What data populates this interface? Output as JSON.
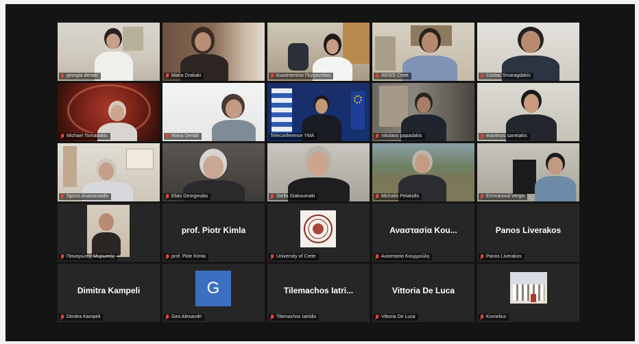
{
  "participants": [
    {
      "name": "georgia deriaki",
      "muted": true
    },
    {
      "name": "Maria Drakaki",
      "muted": true
    },
    {
      "name": "Κωνσταντίνα Περγαντάκη",
      "muted": true
    },
    {
      "name": "ARSIS Crete",
      "muted": true
    },
    {
      "name": "Costas Smaragdakis",
      "muted": true
    },
    {
      "name": "Michael Tornadakis",
      "muted": true
    },
    {
      "name": "Maria Dertali",
      "muted": true
    },
    {
      "name": "Teleconference ΥΜΑ",
      "muted": true,
      "active_speaker": true
    },
    {
      "name": "nikolaos papadakis",
      "muted": true
    },
    {
      "name": "eravimos sanetakis",
      "muted": true
    },
    {
      "name": "Spiros Anastasiadis",
      "muted": true
    },
    {
      "name": "Elias Georgeulas",
      "muted": true
    },
    {
      "name": "Stella Giakoumaki",
      "muted": true
    },
    {
      "name": "Michalis Pelakidis",
      "muted": true
    },
    {
      "name": "Emmanouil Vergis",
      "muted": true
    },
    {
      "name": "Παναγιώτης Μυρωπής",
      "muted": true
    },
    {
      "name": "prof. Piotr Kimla",
      "muted": true,
      "display_name": "prof. Piotr Kimla"
    },
    {
      "name": "University of Crete",
      "muted": true
    },
    {
      "name": "Αναστασία Κουρμούλη",
      "muted": true,
      "display_name": "Αναστασία Kou..."
    },
    {
      "name": "Panos Liverakos",
      "muted": true,
      "display_name": "Panos Liverakos"
    },
    {
      "name": "Dimitra Kampeli",
      "muted": true,
      "display_name": "Dimitra Kampeli"
    },
    {
      "name": "Geo Alexandri",
      "muted": true,
      "avatar_letter": "G"
    },
    {
      "name": "Tilemachos Iatridis",
      "muted": true,
      "display_name": "Tilemachos  Iatri..."
    },
    {
      "name": "Vittoria De Luca",
      "muted": true,
      "display_name": "Vittoria De Luca"
    },
    {
      "name": "Kornelius",
      "muted": true
    }
  ],
  "colors": {
    "active_outline": "#c8d93a",
    "avatar_blue": "#3c6fc2",
    "mic_muted": "#e0453a"
  }
}
